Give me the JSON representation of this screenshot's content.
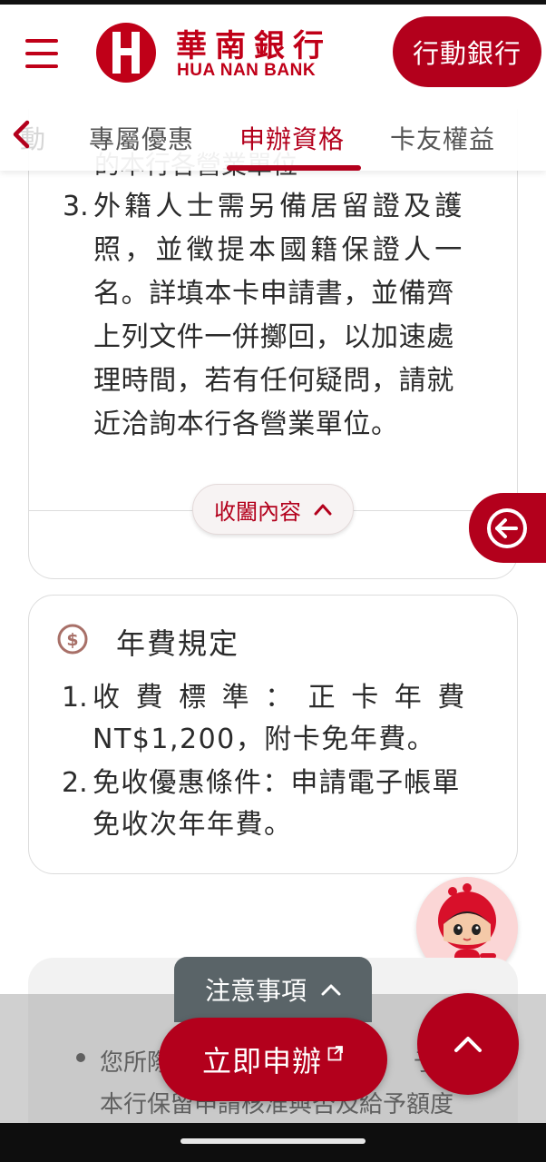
{
  "header": {
    "brand_zh": "華南銀行",
    "brand_en": "HUA NAN BANK",
    "mobile_bank_label": "行動銀行",
    "brand_color": "#c00018"
  },
  "tabs": {
    "partial_prev": "動",
    "items": [
      {
        "label": "專屬優惠",
        "active": false
      },
      {
        "label": "申辦資格",
        "active": true
      },
      {
        "label": "卡友權益",
        "active": false
      }
    ]
  },
  "eligibility": {
    "partial_line": "的本行各營業單位",
    "item3_num": "3.",
    "item3_lines": [
      "外籍人士需另備居留證及護",
      "照，並徵提本國籍保證人一",
      "名。詳填本卡申請書，並備齊",
      "上列文件一併擲回，以加速處",
      "理時間，若有任何疑問，請就",
      "近洽詢本行各營業單位。"
    ],
    "collapse_label": "收闔內容"
  },
  "annual_fee": {
    "icon": "dollar-circle-icon",
    "title": "年費規定",
    "items": [
      {
        "num": "1.",
        "lines": [
          "收 費 標 準 ： 正 卡 年 費",
          "NT$1,200，附卡免年費。"
        ]
      },
      {
        "num": "2.",
        "lines": [
          "免收優惠條件：申請電子帳單",
          "免收次年年費。"
        ]
      }
    ]
  },
  "notice": {
    "tab_label": "注意事項",
    "line1_left": "您所際",
    "line1_right": "予退",
    "line2": "本行保留申請核准與否及給予額度"
  },
  "actions": {
    "apply_label": "立即申辦",
    "apply_ext_icon": "external-link-icon",
    "top_icon": "chevron-up-icon",
    "side_icon": "back-arrow-circle-icon"
  }
}
